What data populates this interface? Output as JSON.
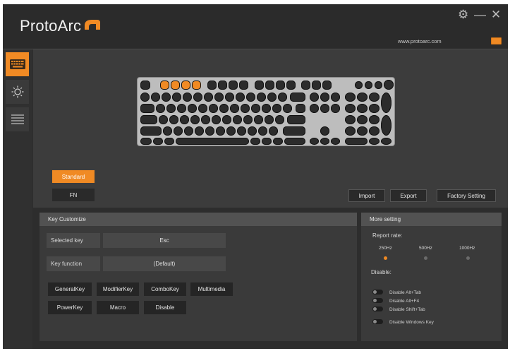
{
  "app": {
    "logo_text": "ProtoArc",
    "website": "www.protoarc.com",
    "accent_color": "#f08a24"
  },
  "window_controls": [
    {
      "icon": "gear-icon",
      "glyph": "⚙"
    },
    {
      "icon": "minimize-icon",
      "glyph": "—"
    },
    {
      "icon": "close-icon",
      "glyph": "✕"
    }
  ],
  "sidebar": {
    "items": [
      {
        "icon": "keyboard-icon",
        "active": true
      },
      {
        "icon": "backlight-icon",
        "active": false
      },
      {
        "icon": "list-icon",
        "active": false
      }
    ]
  },
  "mode_tabs": {
    "standard": "Standard",
    "fn": "FN"
  },
  "actions": {
    "import": "Import",
    "export": "Export",
    "factory": "Factory Setting"
  },
  "key_customize": {
    "title": "Key Customize",
    "selected_key_label": "Selected key",
    "selected_key_value": "Esc",
    "key_function_label": "Key function",
    "key_function_value": "(Default)",
    "buttons": [
      "GeneralKey",
      "ModifierKey",
      "ComboKey",
      "Multimedia",
      "PowerKey",
      "Macro",
      "Disable"
    ]
  },
  "more_setting": {
    "title": "More setting",
    "report_rate_label": "Report rate:",
    "rates": [
      {
        "label": "250Hz",
        "selected": true
      },
      {
        "label": "500Hz",
        "selected": false
      },
      {
        "label": "1000Hz",
        "selected": false
      }
    ],
    "disable_label": "Disable:",
    "disable_options": [
      "Disable Alt+Tab",
      "Disable Alt+F4",
      "Disable Shift+Tab",
      "Disable Windows Key"
    ]
  }
}
